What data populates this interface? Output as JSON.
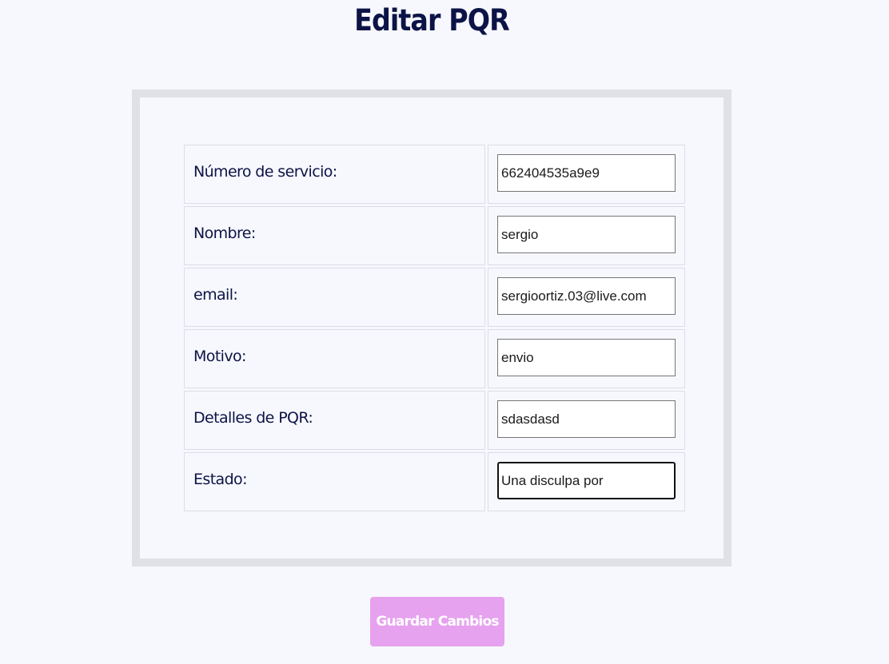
{
  "page": {
    "title": "Editar PQR"
  },
  "form": {
    "rows": [
      {
        "label": "Número de servicio:",
        "value": "662404535a9e9"
      },
      {
        "label": "Nombre:",
        "value": "sergio"
      },
      {
        "label": "email:",
        "value": "sergioortiz.03@live.com"
      },
      {
        "label": "Motivo:",
        "value": "envio"
      },
      {
        "label": "Detalles de PQR:",
        "value": "sdasdasd"
      },
      {
        "label": "Estado:",
        "value": "Una disculpa por"
      }
    ],
    "save_label": "Guardar Cambios"
  },
  "colors": {
    "background": "#f7f8fd",
    "text": "#0c1346",
    "frame": "#dfe1e7",
    "button": "#e6a2ef"
  }
}
